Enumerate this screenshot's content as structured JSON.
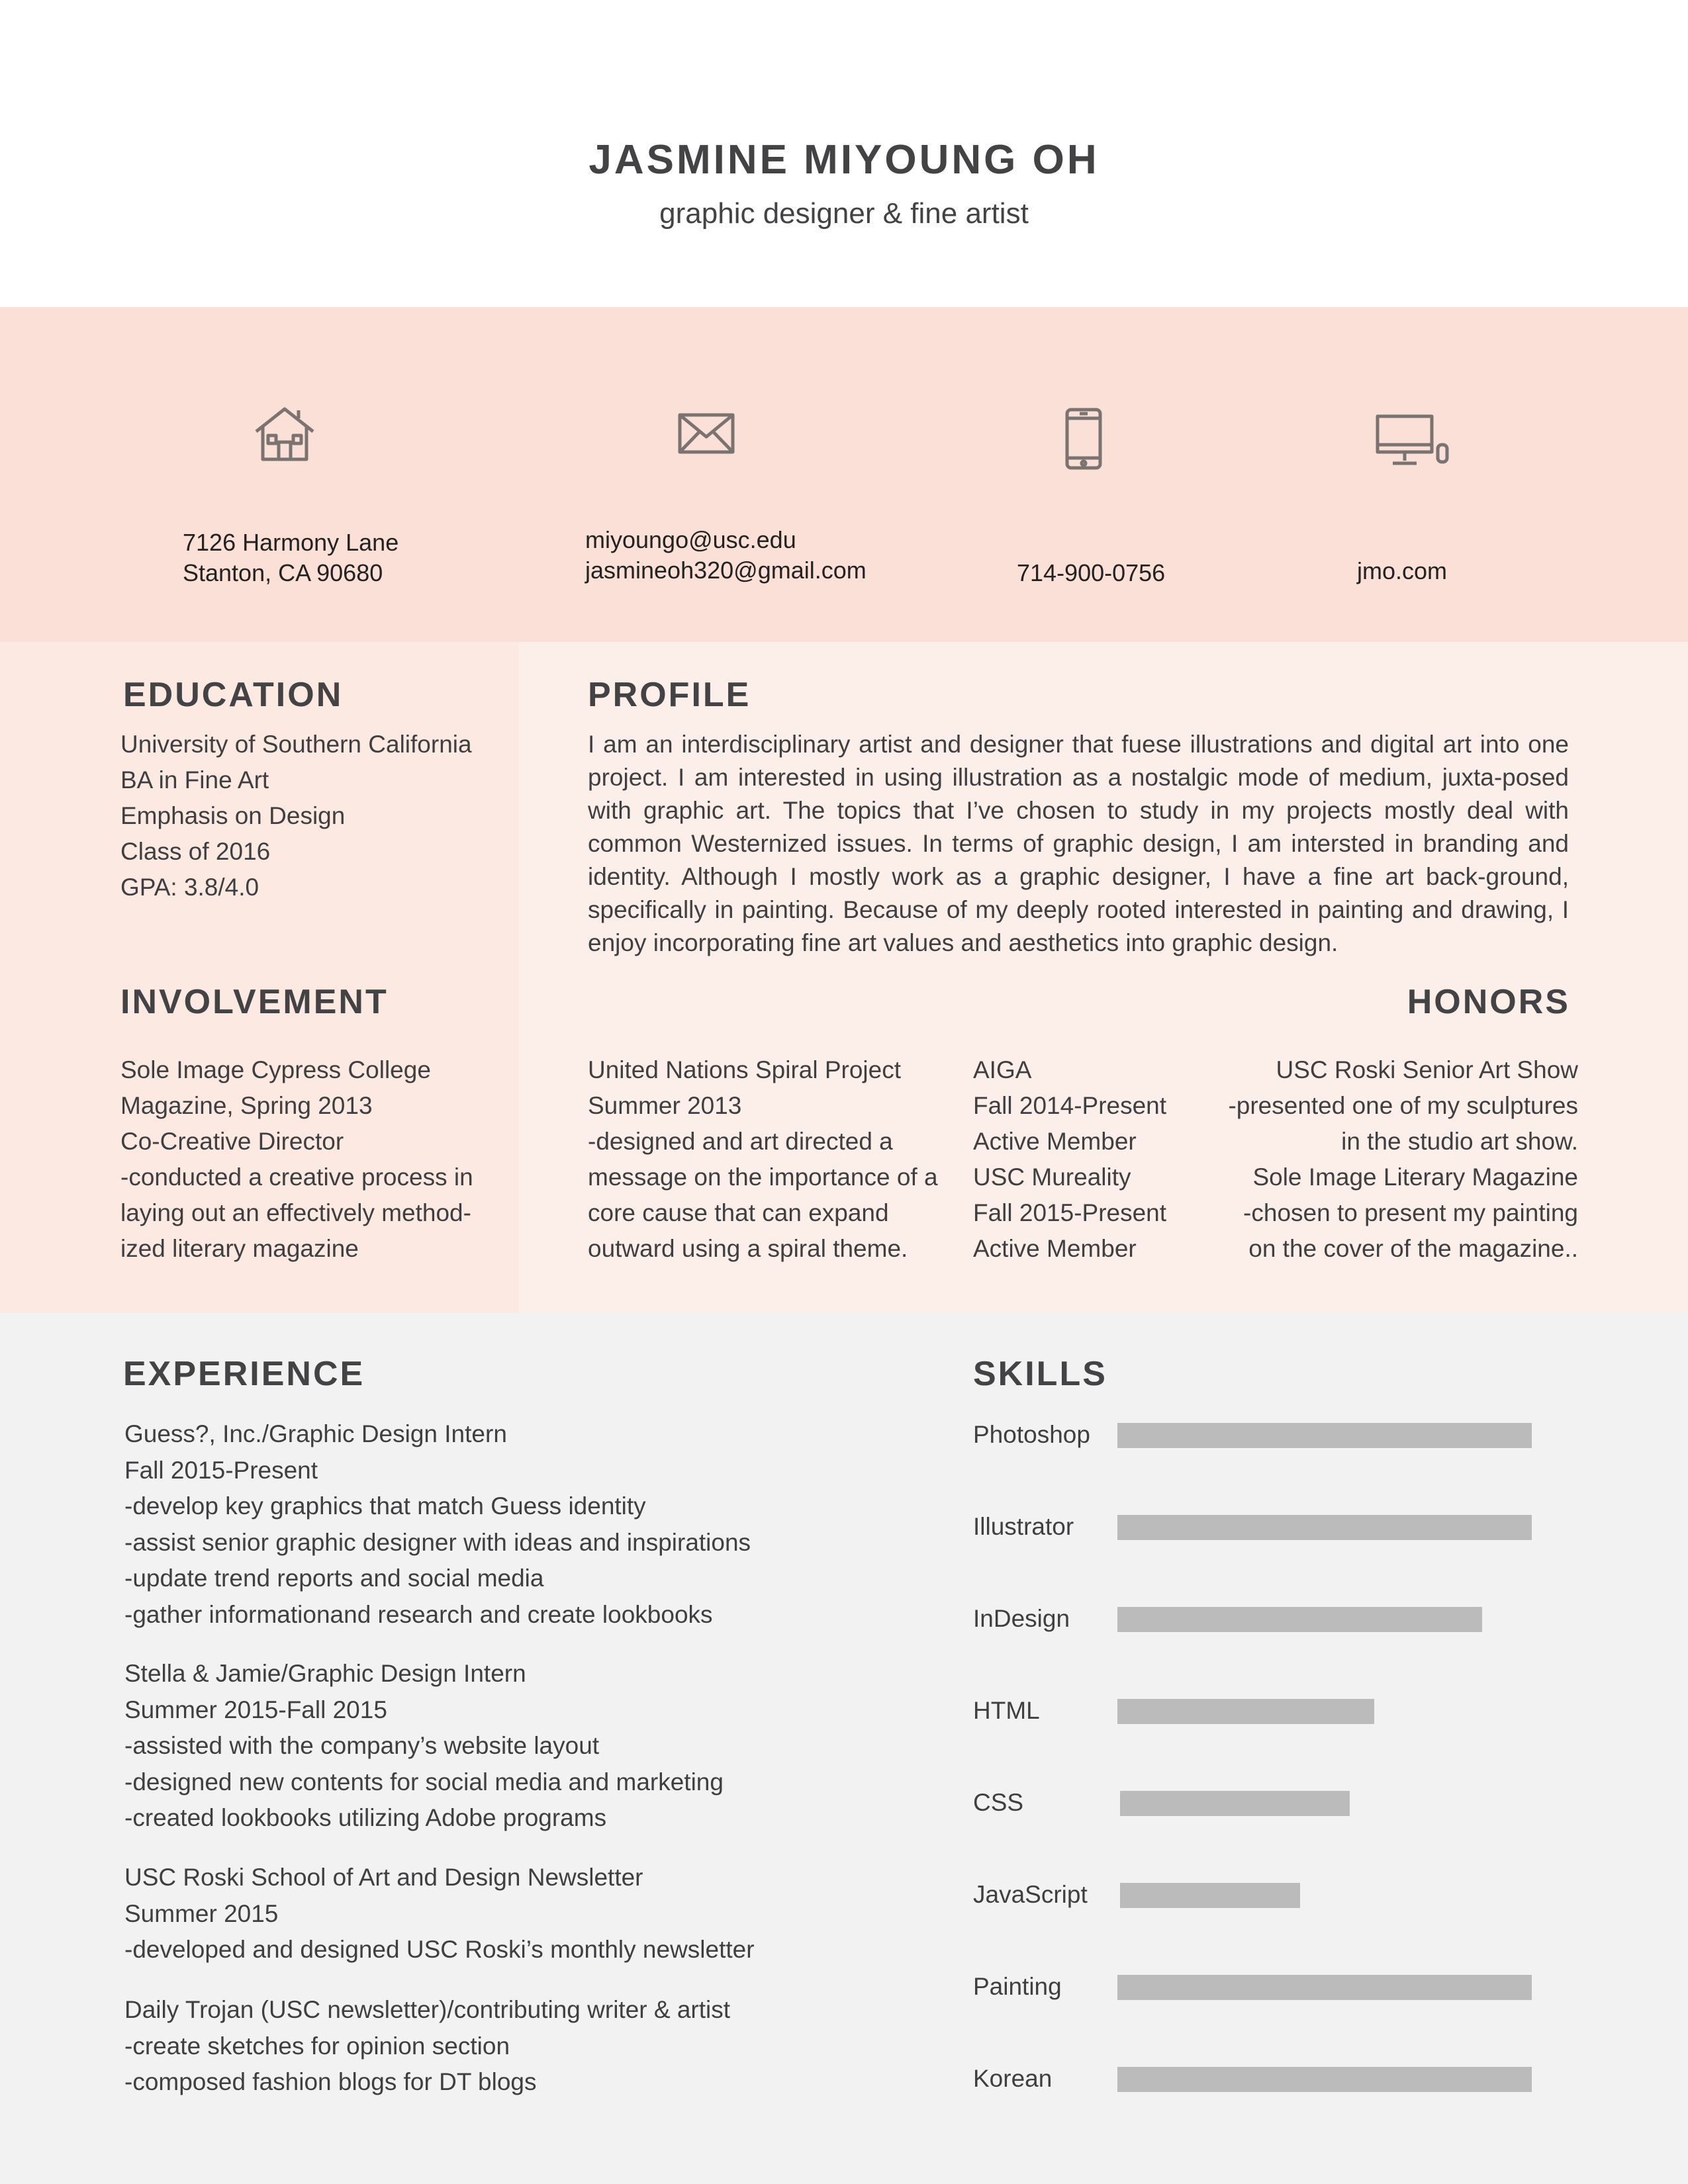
{
  "header": {
    "name": "JASMINE MIYOUNG OH",
    "subtitle": "graphic designer & fine artist"
  },
  "contact": {
    "address": [
      "7126 Harmony Lane",
      "Stanton, CA 90680"
    ],
    "emails": [
      "miyoungo@usc.edu",
      "jasmineoh320@gmail.com"
    ],
    "phone": "714-900-0756",
    "website": "jmo.com",
    "icons": [
      "house-icon",
      "envelope-icon",
      "phone-icon",
      "desktop-icon"
    ],
    "icon_color": "#7b7372"
  },
  "education": {
    "heading": "EDUCATION",
    "lines": [
      "University of Southern California",
      "BA in Fine Art",
      "Emphasis on Design",
      "Class of 2016",
      "GPA: 3.8/4.0"
    ]
  },
  "profile": {
    "heading": "PROFILE",
    "text": "I am an interdisciplinary artist and designer that fuese illustrations and digital art into one project. I am interested in using illustration as a nostalgic mode of medium, juxta-posed with graphic art. The topics that I’ve chosen to study in my projects mostly deal with common Westernized issues. In terms of graphic design, I am intersted in branding and identity. Although I mostly work as a graphic designer, I have a fine art back-ground, specifically in painting. Because of my deeply rooted interested in painting and drawing, I enjoy incorporating fine art values and aesthetics into graphic design."
  },
  "involvement": {
    "heading": "INVOLVEMENT",
    "col1": [
      "Sole Image Cypress College",
      "Magazine, Spring 2013",
      "Co-Creative Director",
      "-conducted a creative process in",
      "laying out an effectively method-",
      "ized literary magazine"
    ],
    "col2": [
      "United Nations Spiral Project",
      "Summer 2013",
      "-designed and art directed a",
      "message on the importance of a",
      "core cause that can expand",
      "outward using a spiral theme."
    ],
    "col3": [
      "AIGA",
      "Fall 2014-Present",
      "Active Member",
      "USC Mureality",
      "Fall 2015-Present",
      "Active Member"
    ]
  },
  "honors": {
    "heading": "HONORS",
    "lines": [
      "USC Roski Senior Art Show",
      "-presented one of my sculptures",
      "in the studio art show.",
      "Sole Image Literary Magazine",
      "-chosen to present my painting",
      "on the cover of the magazine.."
    ]
  },
  "experience": {
    "heading": "EXPERIENCE",
    "jobs": [
      [
        "Guess?, Inc./Graphic Design Intern",
        "Fall 2015-Present",
        "-develop key graphics that match Guess identity",
        "-assist senior graphic designer with ideas and inspirations",
        "-update trend reports and social media",
        "-gather informationand research and create lookbooks"
      ],
      [
        "Stella & Jamie/Graphic Design Intern",
        "Summer 2015-Fall 2015",
        "-assisted with the company’s website layout",
        "-designed new contents for social media and marketing",
        "-created lookbooks utilizing Adobe programs"
      ],
      [
        "USC Roski School of Art and Design Newsletter",
        "Summer 2015",
        "-developed and designed USC Roski’s monthly newsletter"
      ],
      [
        "Daily Trojan (USC newsletter)/contributing writer & artist",
        "-create sketches for opinion section",
        "-composed fashion blogs for DT blogs"
      ]
    ]
  },
  "skills": {
    "heading": "SKILLS",
    "bar_color": "#bbbbbb",
    "items": [
      {
        "label": "Photoshop",
        "level": 1.0
      },
      {
        "label": "Illustrator",
        "level": 1.0
      },
      {
        "label": "InDesign",
        "level": 0.88
      },
      {
        "label": "HTML",
        "level": 0.62
      },
      {
        "label": "CSS",
        "level": 0.555
      },
      {
        "label": "JavaScript",
        "level": 0.435
      },
      {
        "label": "Painting",
        "level": 1.0
      },
      {
        "label": "Korean",
        "level": 1.0
      }
    ]
  }
}
